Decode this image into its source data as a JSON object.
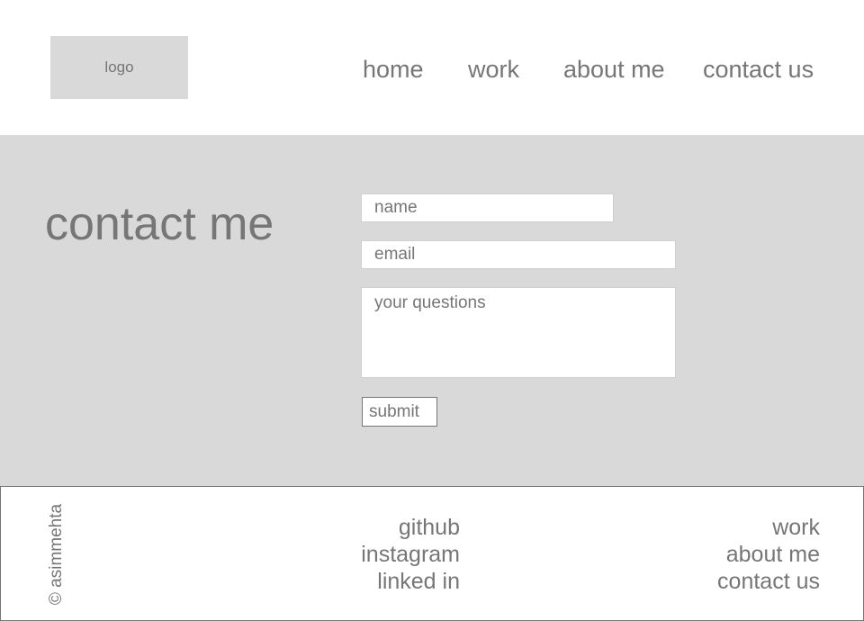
{
  "header": {
    "logo": "logo",
    "nav": [
      "home",
      "work",
      "about me",
      "contact us"
    ]
  },
  "main": {
    "title": "contact me",
    "form": {
      "name_placeholder": "name",
      "email_placeholder": "email",
      "questions_placeholder": "your questions",
      "submit_label": "submit"
    }
  },
  "footer": {
    "copyright": "© asimmehta",
    "social": [
      "github",
      "instagram",
      "linked in"
    ],
    "nav": [
      "work",
      "about me",
      "contact us"
    ]
  }
}
